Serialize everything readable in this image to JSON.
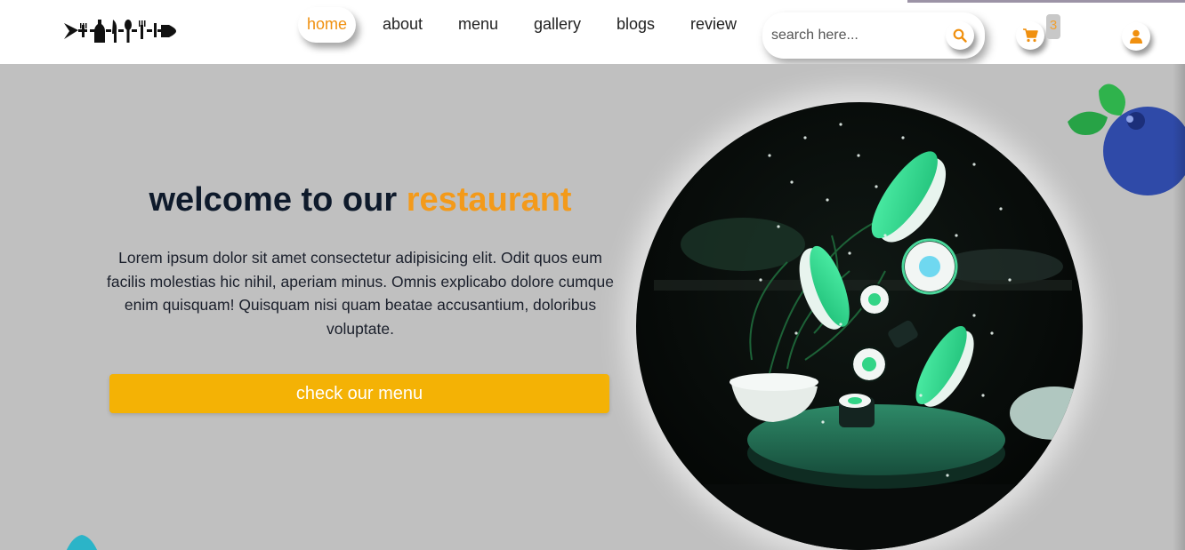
{
  "header": {
    "nav": [
      {
        "label": "home",
        "active": true
      },
      {
        "label": "about",
        "active": false
      },
      {
        "label": "menu",
        "active": false
      },
      {
        "label": "gallery",
        "active": false
      },
      {
        "label": "blogs",
        "active": false
      },
      {
        "label": "review",
        "active": false
      }
    ],
    "search": {
      "placeholder": "search here..."
    },
    "cart": {
      "count": "3"
    },
    "icons": [
      "logo-icon",
      "search-icon",
      "cart-icon",
      "user-icon"
    ],
    "accent_color": "#f0900f"
  },
  "hero": {
    "title_prefix": "welcome to our",
    "title_accent": "restaurant",
    "text": "Lorem ipsum dolor sit amet consectetur adipisicing elit. Odit quos eum facilis molestias hic nihil, aperiam minus. Omnis explicabo dolore cumque enim quisquam! Quisquam nisi quam beatae accusantium, doloribus voluptate.",
    "button_label": "check our menu",
    "button_color": "#f4b205",
    "background_color": "#c0c0c0",
    "image": "sushi-splash-image"
  }
}
